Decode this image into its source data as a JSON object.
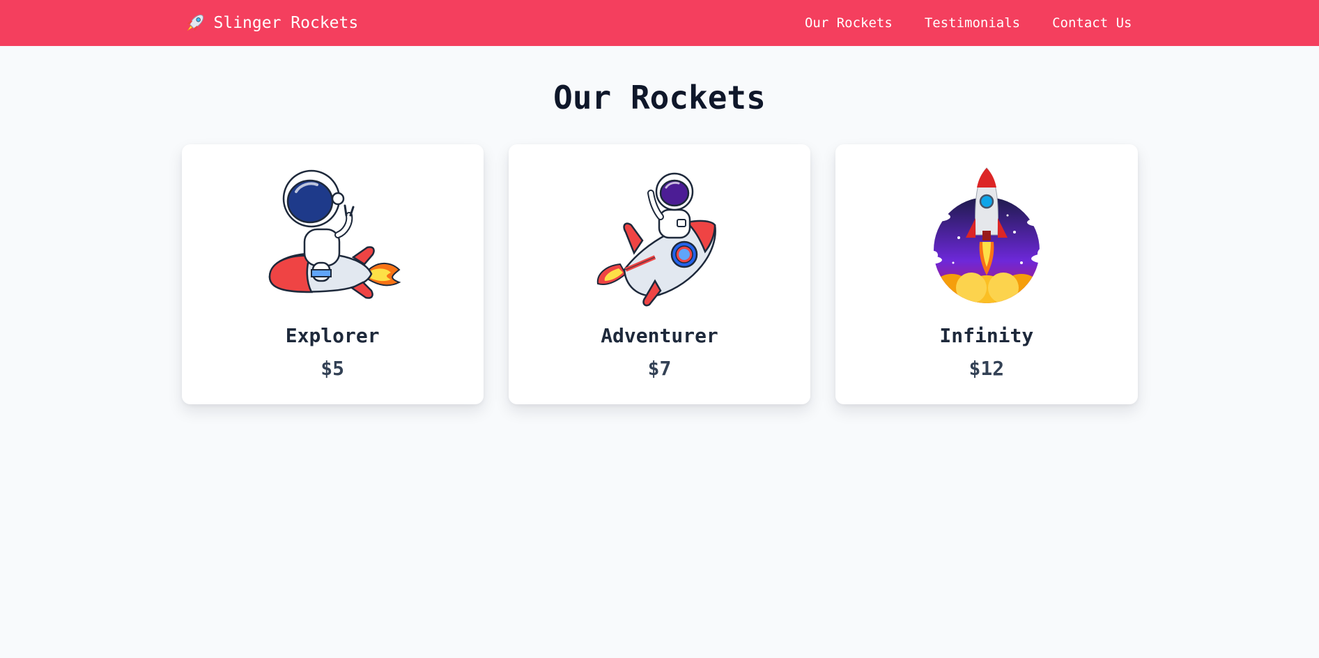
{
  "navbar": {
    "brand_icon": "rocket-icon",
    "brand_label": "Slinger Rockets",
    "links": [
      "Our Rockets",
      "Testimonials",
      "Contact Us"
    ],
    "background_color": "#f43f5e"
  },
  "main": {
    "title": "Our Rockets",
    "products": [
      {
        "name": "Explorer",
        "price": "$5",
        "image": "astronaut-riding-rocket-illustration"
      },
      {
        "name": "Adventurer",
        "price": "$7",
        "image": "astronaut-waving-on-rocket-illustration"
      },
      {
        "name": "Infinity",
        "price": "$12",
        "image": "rocket-launch-night-sky-illustration"
      }
    ]
  }
}
